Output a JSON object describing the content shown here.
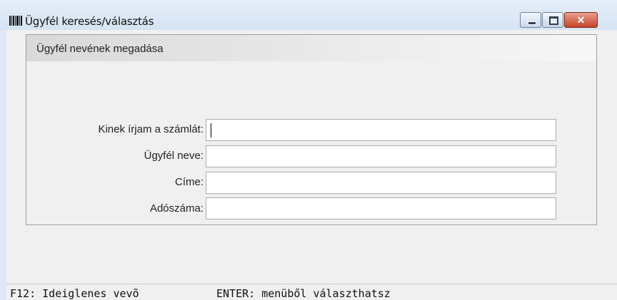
{
  "window": {
    "title": "Ügyfél keresés/választás",
    "icon": "barcode-icon"
  },
  "controls": {
    "minimize_icon": "minimize-icon",
    "maximize_icon": "maximize-icon",
    "close_icon": "close-icon",
    "close_color": "#c6432a"
  },
  "panel": {
    "title": "Ügyfél nevének megadása"
  },
  "form": {
    "fields": [
      {
        "label": "Kinek írjam a számlát:",
        "value": ""
      },
      {
        "label": "Ügyfél neve:",
        "value": ""
      },
      {
        "label": "Címe:",
        "value": ""
      },
      {
        "label": "Adószáma:",
        "value": ""
      }
    ]
  },
  "status": {
    "left": "F12: Ideiglenes vevõ",
    "right": "ENTER: menüből választhatsz"
  }
}
